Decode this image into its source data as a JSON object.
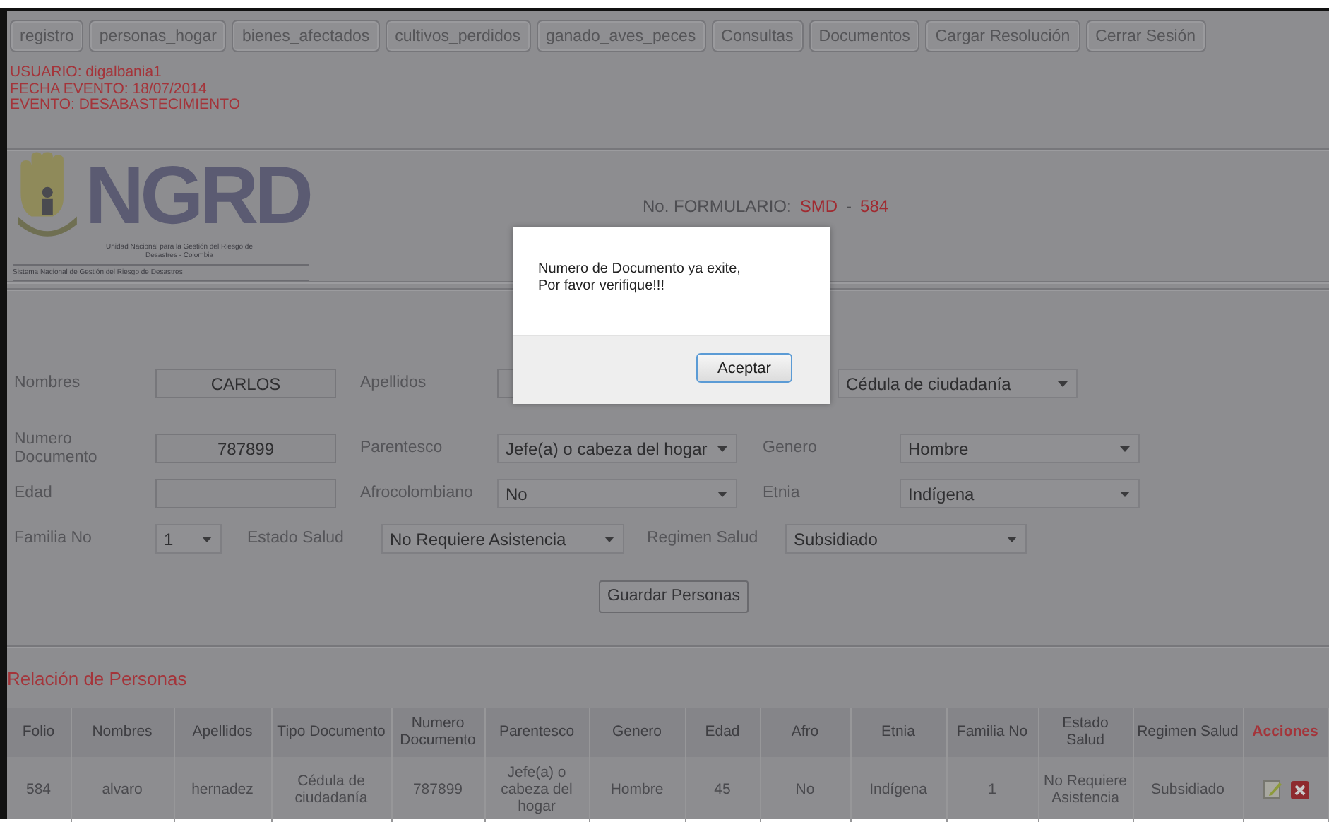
{
  "nav": [
    "registro",
    "personas_hogar",
    "bienes_afectados",
    "cultivos_perdidos",
    "ganado_aves_peces",
    "Consultas",
    "Documentos",
    "Cargar Resolución",
    "Cerrar Sesión"
  ],
  "session": [
    "USUARIO: digalbania1",
    "FECHA EVENTO: 18/07/2014",
    "EVENTO: DESABASTECIMIENTO"
  ],
  "logo": {
    "wordmark": "NGRD",
    "subtitle": "Unidad Nacional para la Gestión del Riesgo de Desastres - Colombia",
    "tagline": "Sistema Nacional de Gestión del Riesgo de Desastres"
  },
  "form_number": {
    "label": "No. FORMULARIO:",
    "prefix": "SMD",
    "separator": "-",
    "number": "584"
  },
  "form": {
    "rows": [
      [
        {
          "label": "Nombres",
          "kind": "input",
          "value": "CARLOS"
        },
        {
          "label": "Apellidos",
          "kind": "input"
        },
        {
          "kind": "select",
          "value": "Cédula de ciudadanía"
        }
      ],
      [
        {
          "label": "Numero Documento",
          "kind": "input",
          "value": "787899"
        },
        {
          "label": "Parentesco",
          "kind": "select",
          "value": "Jefe(a) o cabeza del hogar"
        },
        {
          "label": "Genero",
          "kind": "select",
          "value": "Hombre"
        }
      ],
      [
        {
          "label": "Edad",
          "kind": "input"
        },
        {
          "label": "Afrocolombiano",
          "kind": "select",
          "value": "No"
        },
        {
          "label": "Etnia",
          "kind": "select",
          "value": "Indígena"
        }
      ],
      [
        {
          "label": "Familia No",
          "kind": "select",
          "value": "1"
        },
        {
          "label": "Estado Salud",
          "kind": "select",
          "value": "No Requiere Asistencia"
        },
        {
          "label": "Regimen Salud",
          "kind": "select",
          "value": "Subsidiado"
        }
      ]
    ],
    "save_button": "Guardar Personas"
  },
  "dialog": {
    "message": "Numero de Documento ya exite,\n Por favor verifique!!!",
    "button": "Aceptar"
  },
  "table": {
    "title": "Relación de Personas",
    "columns": [
      "Folio",
      "Nombres",
      "Apellidos",
      "Tipo Documento",
      "Numero Documento",
      "Parentesco",
      "Genero",
      "Edad",
      "Afro",
      "Etnia",
      "Familia No",
      "Estado Salud",
      "Regimen Salud",
      "Acciones"
    ],
    "rows": [
      {
        "cells": [
          "584",
          "alvaro",
          "hernadez",
          "Cédula de ciudadanía",
          "787899",
          "Jefe(a) o cabeza del hogar",
          "Hombre",
          "45",
          "No",
          "Indígena",
          "1",
          "No Requiere Asistencia",
          "Subsidiado"
        ]
      }
    ]
  }
}
